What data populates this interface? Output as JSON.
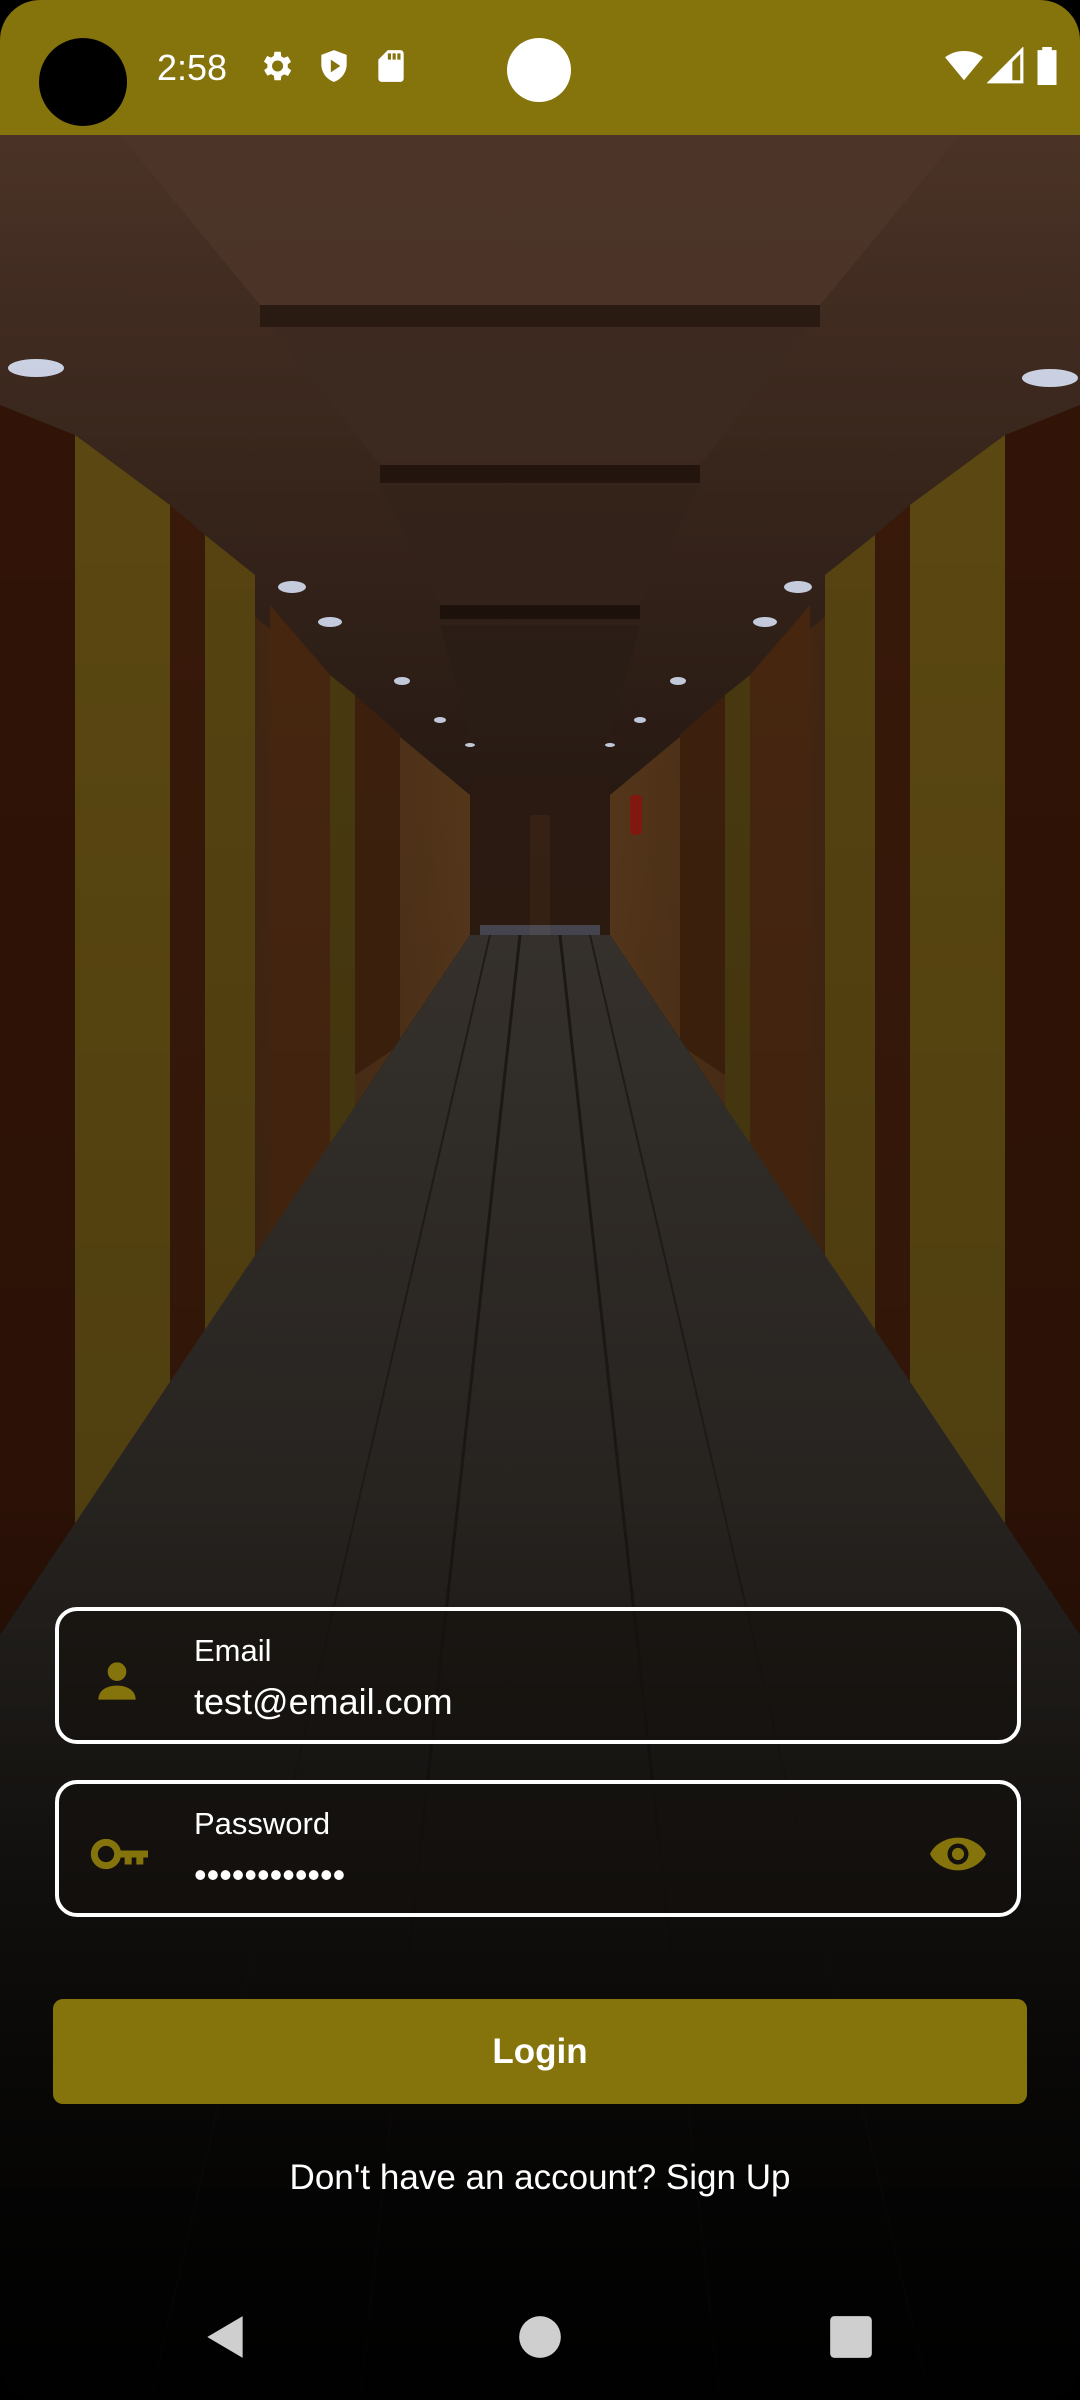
{
  "status_bar": {
    "time": "2:58",
    "icons": [
      "gear-icon",
      "shield-play-icon",
      "sd-card-icon",
      "wifi-icon",
      "signal-icon",
      "battery-icon"
    ],
    "color": "#85730c"
  },
  "form": {
    "email": {
      "label": "Email",
      "value": "test@email.com",
      "icon": "person-icon"
    },
    "password": {
      "label": "Password",
      "value": "••••••••••••",
      "icon": "key-icon",
      "toggle_icon": "eye-icon"
    },
    "login_label": "Login",
    "signup_text": "Don't have an account? Sign Up"
  },
  "navigation": {
    "buttons": [
      "back-icon",
      "home-icon",
      "recents-icon"
    ]
  },
  "colors": {
    "accent": "#85730c",
    "text": "#ffffff",
    "background": "#000000"
  }
}
